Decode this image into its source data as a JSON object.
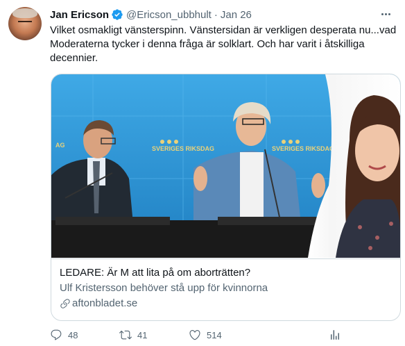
{
  "author": {
    "name": "Jan Ericson",
    "handle": "@Ericson_ubbhult",
    "separator": "·",
    "time": "Jan 26",
    "verified": true
  },
  "tweet": {
    "text": "Vilket osmakligt vänsterspinn. Vänstersidan är verkligen desperata nu...vad Moderaterna tycker i denna fråga är solklart. Och har varit i åtskilliga decennier."
  },
  "card": {
    "title": "LEDARE: Är M att lita på om aborträtten?",
    "description": "Ulf Kristersson behöver stå upp för kvinnorna",
    "domain": "aftonbladet.se",
    "image": {
      "backdrop_text_1": "SVERIGES RIKSDAG",
      "backdrop_text_2": "SVERIGES RIKSDAG",
      "backdrop_text_left": "AG"
    }
  },
  "actions": {
    "replies": "48",
    "retweets": "41",
    "likes": "514"
  },
  "colors": {
    "text": "#0f1419",
    "secondary": "#536471",
    "verified": "#1d9bf0",
    "border": "#cfd9de",
    "riksdag_blue": "#2a9ad8"
  },
  "icons": [
    "verified-badge-icon",
    "more-icon",
    "link-icon",
    "reply-icon",
    "retweet-icon",
    "like-icon",
    "share-icon"
  ]
}
